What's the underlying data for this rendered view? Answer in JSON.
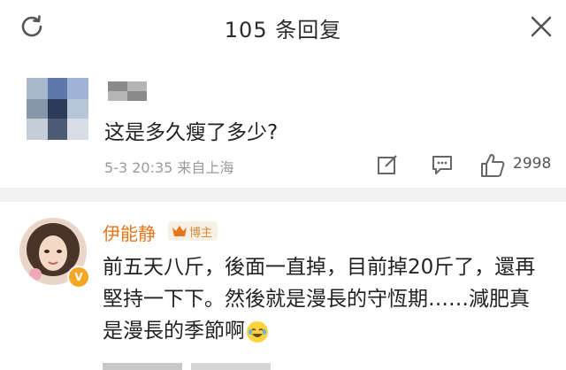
{
  "header": {
    "title": "105 条回复"
  },
  "comments": [
    {
      "text": "这是多久瘦了多少?",
      "time": "5-3 20:35",
      "source": "来自上海",
      "likes": "2998"
    },
    {
      "author": "伊能静",
      "badge": "博主",
      "verified_mark": "V",
      "text": "前五天八斤，後面一直掉，目前掉20斤了，還再堅持一下下。然後就是漫長的守恆期……減肥真是漫長的季節啊"
    }
  ],
  "colors": {
    "author_orange": "#e8741a",
    "badge_bg": "#f7f0e6",
    "meta_grey": "#9a9a9a"
  },
  "icons": [
    "refresh-icon",
    "close-icon",
    "share-icon",
    "comment-icon",
    "like-icon",
    "crown-icon",
    "laughing-emoji"
  ]
}
